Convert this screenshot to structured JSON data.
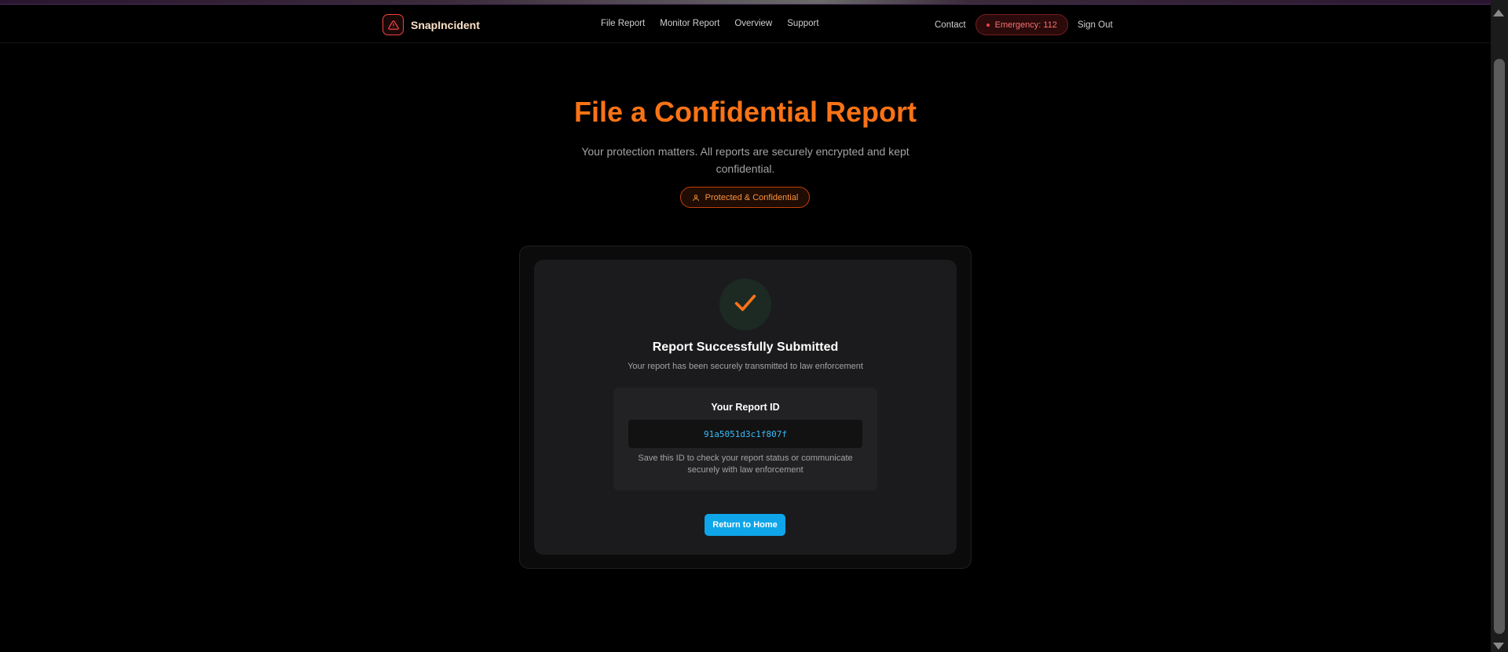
{
  "app": {
    "name": "SnapIncident"
  },
  "nav": {
    "links": [
      "File Report",
      "Monitor Report",
      "Overview",
      "Support"
    ],
    "contact": "Contact",
    "emergency": "Emergency: 112",
    "sign_out": "Sign Out"
  },
  "hero": {
    "title": "File a Confidential Report",
    "subtitle": "Your protection matters. All reports are securely encrypted and kept confidential.",
    "badge": "Protected & Confidential"
  },
  "success": {
    "title": "Report Successfully Submitted",
    "subtitle": "Your report has been securely transmitted to law enforcement",
    "id_label": "Your Report ID",
    "id_value": "91a5051d3c1f807f",
    "id_note": "Save this ID to check your report status or communicate securely with law enforcement",
    "button": "Return to Home"
  },
  "colors": {
    "accent": "#f97316",
    "primary_button": "#0ea5e9",
    "emergency": "#ef4444",
    "report_id": "#38bdf8"
  },
  "icons": {
    "brand": "alert-triangle-icon",
    "badge": "user-icon",
    "success": "checkmark-icon"
  }
}
